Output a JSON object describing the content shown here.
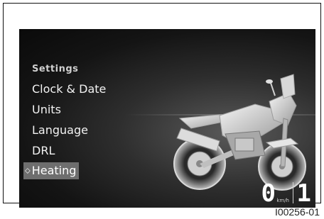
{
  "menu": {
    "title": "Settings",
    "items": [
      {
        "label": "Clock & Date"
      },
      {
        "label": "Units"
      },
      {
        "label": "Language"
      },
      {
        "label": "DRL"
      }
    ],
    "selected": {
      "label": "Heating",
      "marker": "⬦"
    }
  },
  "dashboard": {
    "speed": "0",
    "speed_unit": "km/h",
    "gear": "1"
  },
  "figure": {
    "id": "I00256-01"
  },
  "icons": [
    "selection-arrow-icon",
    "motorcycle-image"
  ]
}
